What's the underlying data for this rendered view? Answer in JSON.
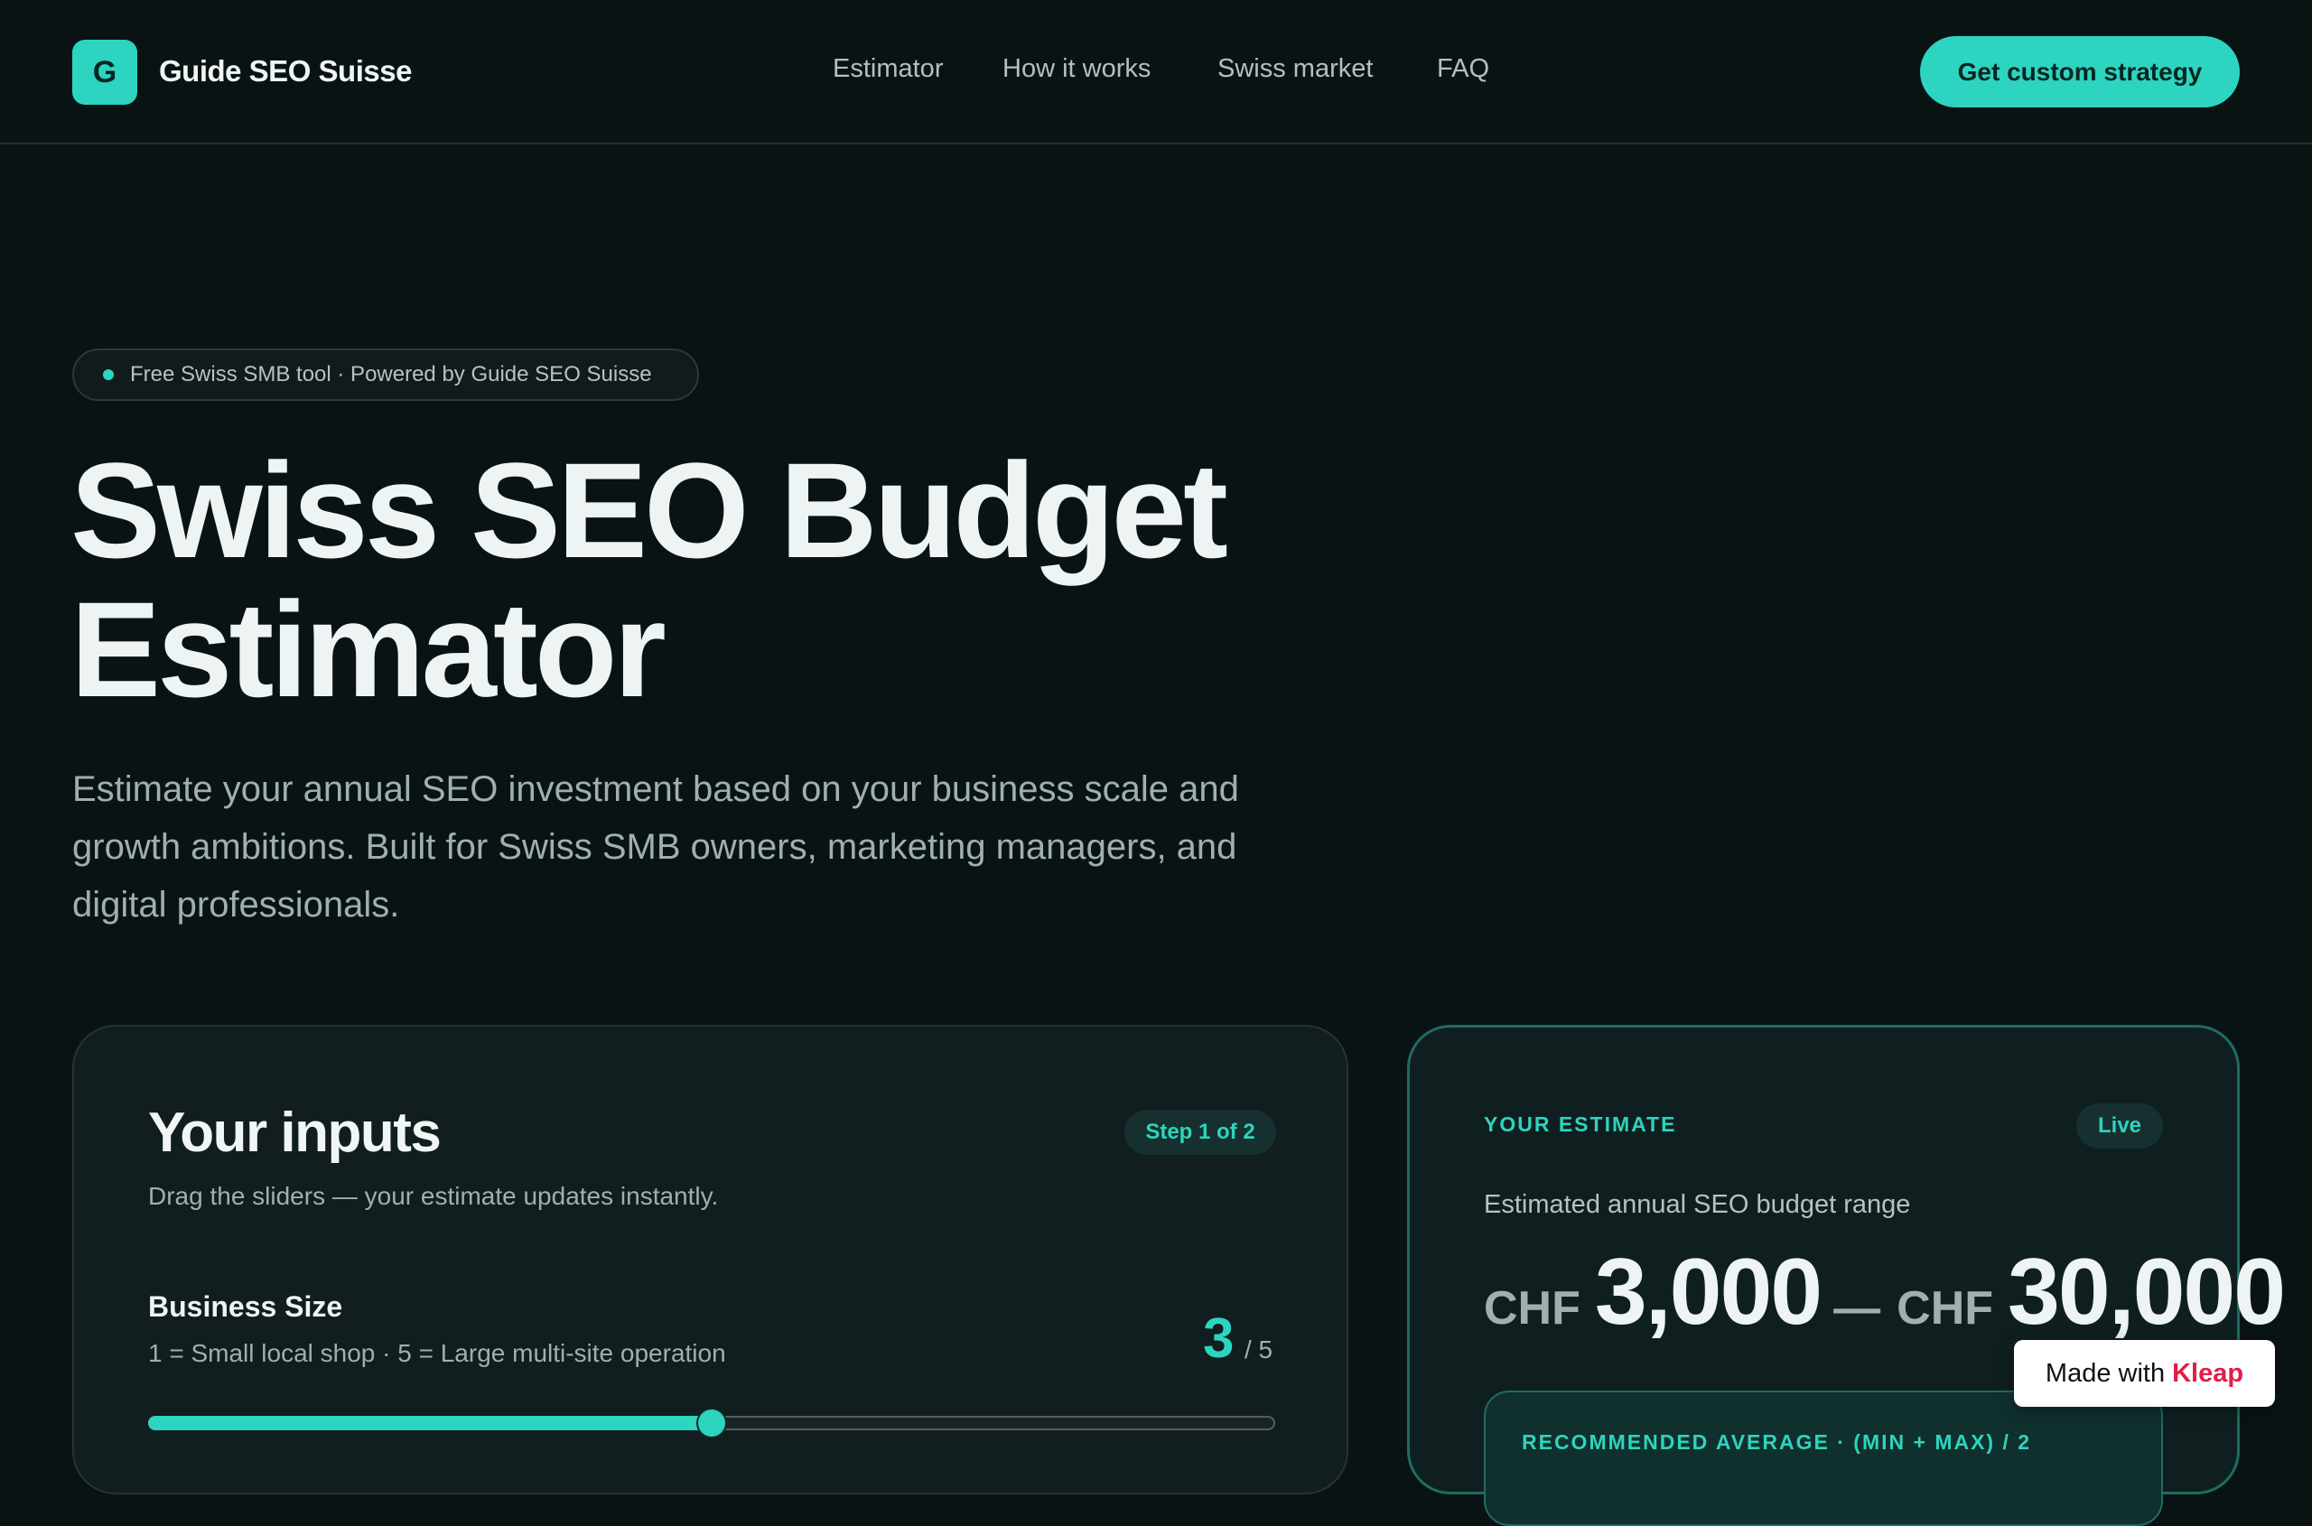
{
  "header": {
    "logo_letter": "G",
    "brand": "Guide SEO Suisse",
    "nav": [
      "Estimator",
      "How it works",
      "Swiss market",
      "FAQ"
    ],
    "cta": "Get custom strategy"
  },
  "hero": {
    "pill": "Free Swiss SMB tool · Powered by Guide SEO Suisse",
    "title_line1": "Swiss SEO Budget",
    "title_line2": "Estimator",
    "lede": "Estimate your annual SEO investment based on your business scale and growth ambitions. Built for Swiss SMB owners, marketing managers, and digital professionals."
  },
  "inputs": {
    "title": "Your inputs",
    "step": "Step 1 of 2",
    "subtitle": "Drag the sliders — your estimate updates instantly.",
    "business_size": {
      "label": "Business Size",
      "hint": "1 = Small local shop · 5 = Large multi-site operation",
      "value": "3",
      "max": "/ 5",
      "level": 0.5
    }
  },
  "estimate": {
    "heading": "YOUR ESTIMATE",
    "live": "Live",
    "label": "Estimated annual SEO budget range",
    "currency": "CHF",
    "min": "3,000",
    "sep": "—",
    "max": "30,000",
    "recommended_label": "RECOMMENDED AVERAGE · (MIN + MAX) / 2"
  },
  "badge": {
    "made_with": "Made with",
    "brand": "Kleap"
  },
  "colors": {
    "accent": "#2dd4bf",
    "background": "#0a1314",
    "card": "#111d1e",
    "badge_brand": "#e11d48"
  }
}
